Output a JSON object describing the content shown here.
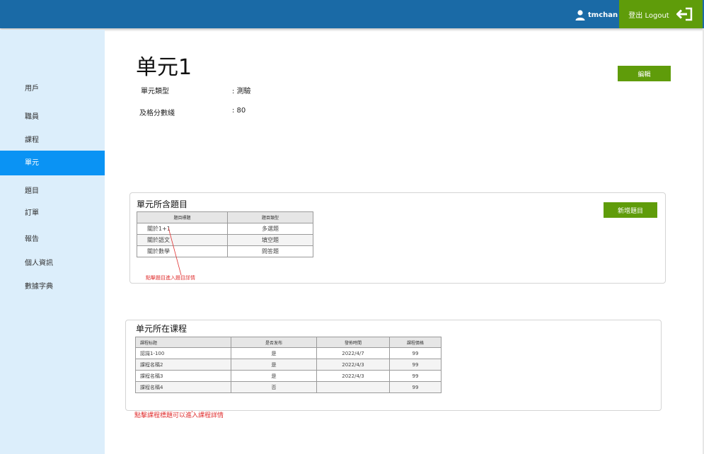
{
  "header": {
    "username": "tmchan",
    "logout_label": "登出 Logout"
  },
  "sidebar": {
    "items": [
      {
        "label": "用戶"
      },
      {
        "label": "職員"
      },
      {
        "label": "課程"
      },
      {
        "label": "單元",
        "active": true
      },
      {
        "label": "題目"
      },
      {
        "label": "訂單"
      },
      {
        "label": "報告"
      },
      {
        "label": "個人資訊"
      },
      {
        "label": "數據字典"
      }
    ]
  },
  "unit": {
    "title": "单元1",
    "type_label": "單元類型",
    "type_value": ": 測驗",
    "pass_label": "及格分數綫",
    "pass_value": ": 80",
    "edit_label": "編輯"
  },
  "questions": {
    "title": "單元所含題目",
    "add_label": "新增題目",
    "headers": [
      "題目標題",
      "題目類型"
    ],
    "rows": [
      [
        "關於1+1",
        "多選題"
      ],
      [
        "關於語文",
        "填空題"
      ],
      [
        "關於數學",
        "問答題"
      ]
    ],
    "note": "點擊題目進入題目詳情"
  },
  "courses": {
    "title": "单元所在课程",
    "headers": [
      "課程标题",
      "是否发布",
      "發佈時間",
      "課程價格"
    ],
    "rows": [
      [
        "認識1-100",
        "是",
        "2022/4/7",
        "99"
      ],
      [
        "課程名稱2",
        "是",
        "2022/4/3",
        "99"
      ],
      [
        "課程名稱3",
        "是",
        "2022/4/3",
        "99"
      ],
      [
        "課程名稱4",
        "否",
        "",
        "99"
      ]
    ],
    "note": "點擊課程標題可以進入課程詳情"
  },
  "colors": {
    "header": "#1a6aa6",
    "accent_green": "#5f9c0a",
    "sidebar_bg": "#dceefb",
    "active": "#0a93f4",
    "note": "#e03030"
  },
  "icons": [
    "user-icon",
    "logout-icon"
  ]
}
